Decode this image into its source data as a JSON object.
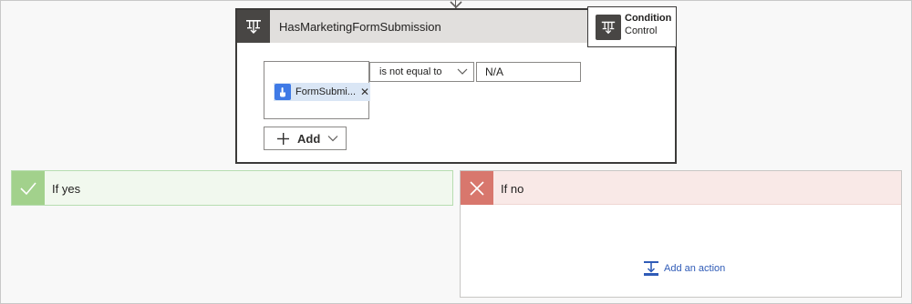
{
  "condition": {
    "title": "HasMarketingFormSubmission",
    "popup": {
      "title": "Condition",
      "subtitle": "Control"
    },
    "operand": {
      "token_label": "FormSubmi...",
      "remove_glyph": "✕"
    },
    "operator": {
      "selected": "is not equal to"
    },
    "value": {
      "current": "N/A"
    },
    "add_button": {
      "label": "Add"
    }
  },
  "branches": {
    "yes": {
      "label": "If yes",
      "color": "#a2d18c"
    },
    "no": {
      "label": "If no",
      "color": "#d8776d",
      "add_action_label": "Add an action"
    }
  },
  "icons": {
    "header": "condition-icon",
    "popup": "condition-icon",
    "token": "touch-hand-icon",
    "yes": "checkmark-icon",
    "no": "close-icon",
    "add_action": "add-action-icon"
  }
}
